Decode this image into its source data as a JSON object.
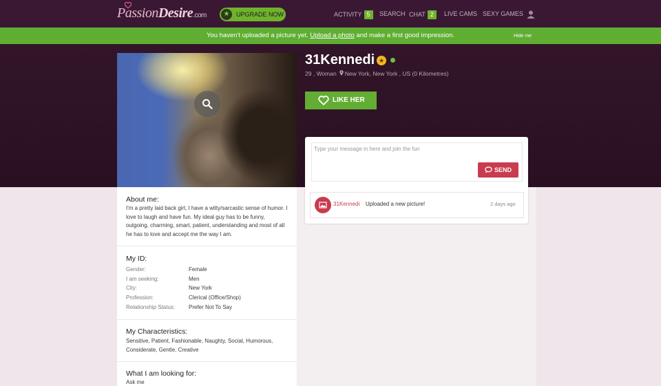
{
  "nav": {
    "logo_passion": "Passion",
    "logo_desire": "Desire",
    "logo_dom": ".com",
    "upgrade_label": "UPGRADE NOW",
    "activity_label": "ACTIVITY",
    "activity_count": "5",
    "search_label": "SEARCH",
    "chat_label": "CHAT",
    "chat_count": "2",
    "live_cams_label": "LIVE CAMS",
    "sexy_games_label": "SEXY GAMES",
    "accent_color": "#6fb32d"
  },
  "notice": {
    "before": "You haven't uploaded a picture yet. ",
    "link": "Upload a photo",
    "after": " and make a first good impression.",
    "hide": "Hide me"
  },
  "profile": {
    "username": "31Kennedi",
    "age": "29",
    "gender": "Woman",
    "location": "New York, New York , US (0 Kilometres)",
    "like_label": "LIKE HER",
    "online": true
  },
  "message": {
    "placeholder": "Type your message in here and join the fun",
    "send_label": "SEND"
  },
  "activity_feed": [
    {
      "user": "31Kennedi",
      "text": "Uploaded a new picture!",
      "time": "2 days ago"
    }
  ],
  "about": {
    "title": "About me:",
    "text": "I'm a pretty laid back girl, I have a witty/sarcastic sense of humor. I love to laugh and have fun. My ideal guy has to be funny, outgoing, charming, smart, patient, understanding and most of all he has to love and accept me the way I am."
  },
  "my_id": {
    "title": "My ID:",
    "rows": [
      {
        "label": "Gender:",
        "value": "Female"
      },
      {
        "label": "I am seeking:",
        "value": "Men"
      },
      {
        "label": "City:",
        "value": "New York"
      },
      {
        "label": "Profession:",
        "value": "Clerical (Office/Shop)"
      },
      {
        "label": "Relationship Status:",
        "value": "Prefer Not To Say"
      }
    ]
  },
  "characteristics": {
    "title": "My Characteristics:",
    "text": "Sensitive, Patient, Fashionable, Naughty, Social, Humorous, Considerate, Gentle, Creative"
  },
  "looking_for": {
    "title": "What I am looking for:",
    "text": "Ask me"
  },
  "colors": {
    "header_bg": "#3a1833",
    "notice_bg": "#5fae32",
    "send_bg": "#c93b4e",
    "premium": "#f3b71e"
  }
}
